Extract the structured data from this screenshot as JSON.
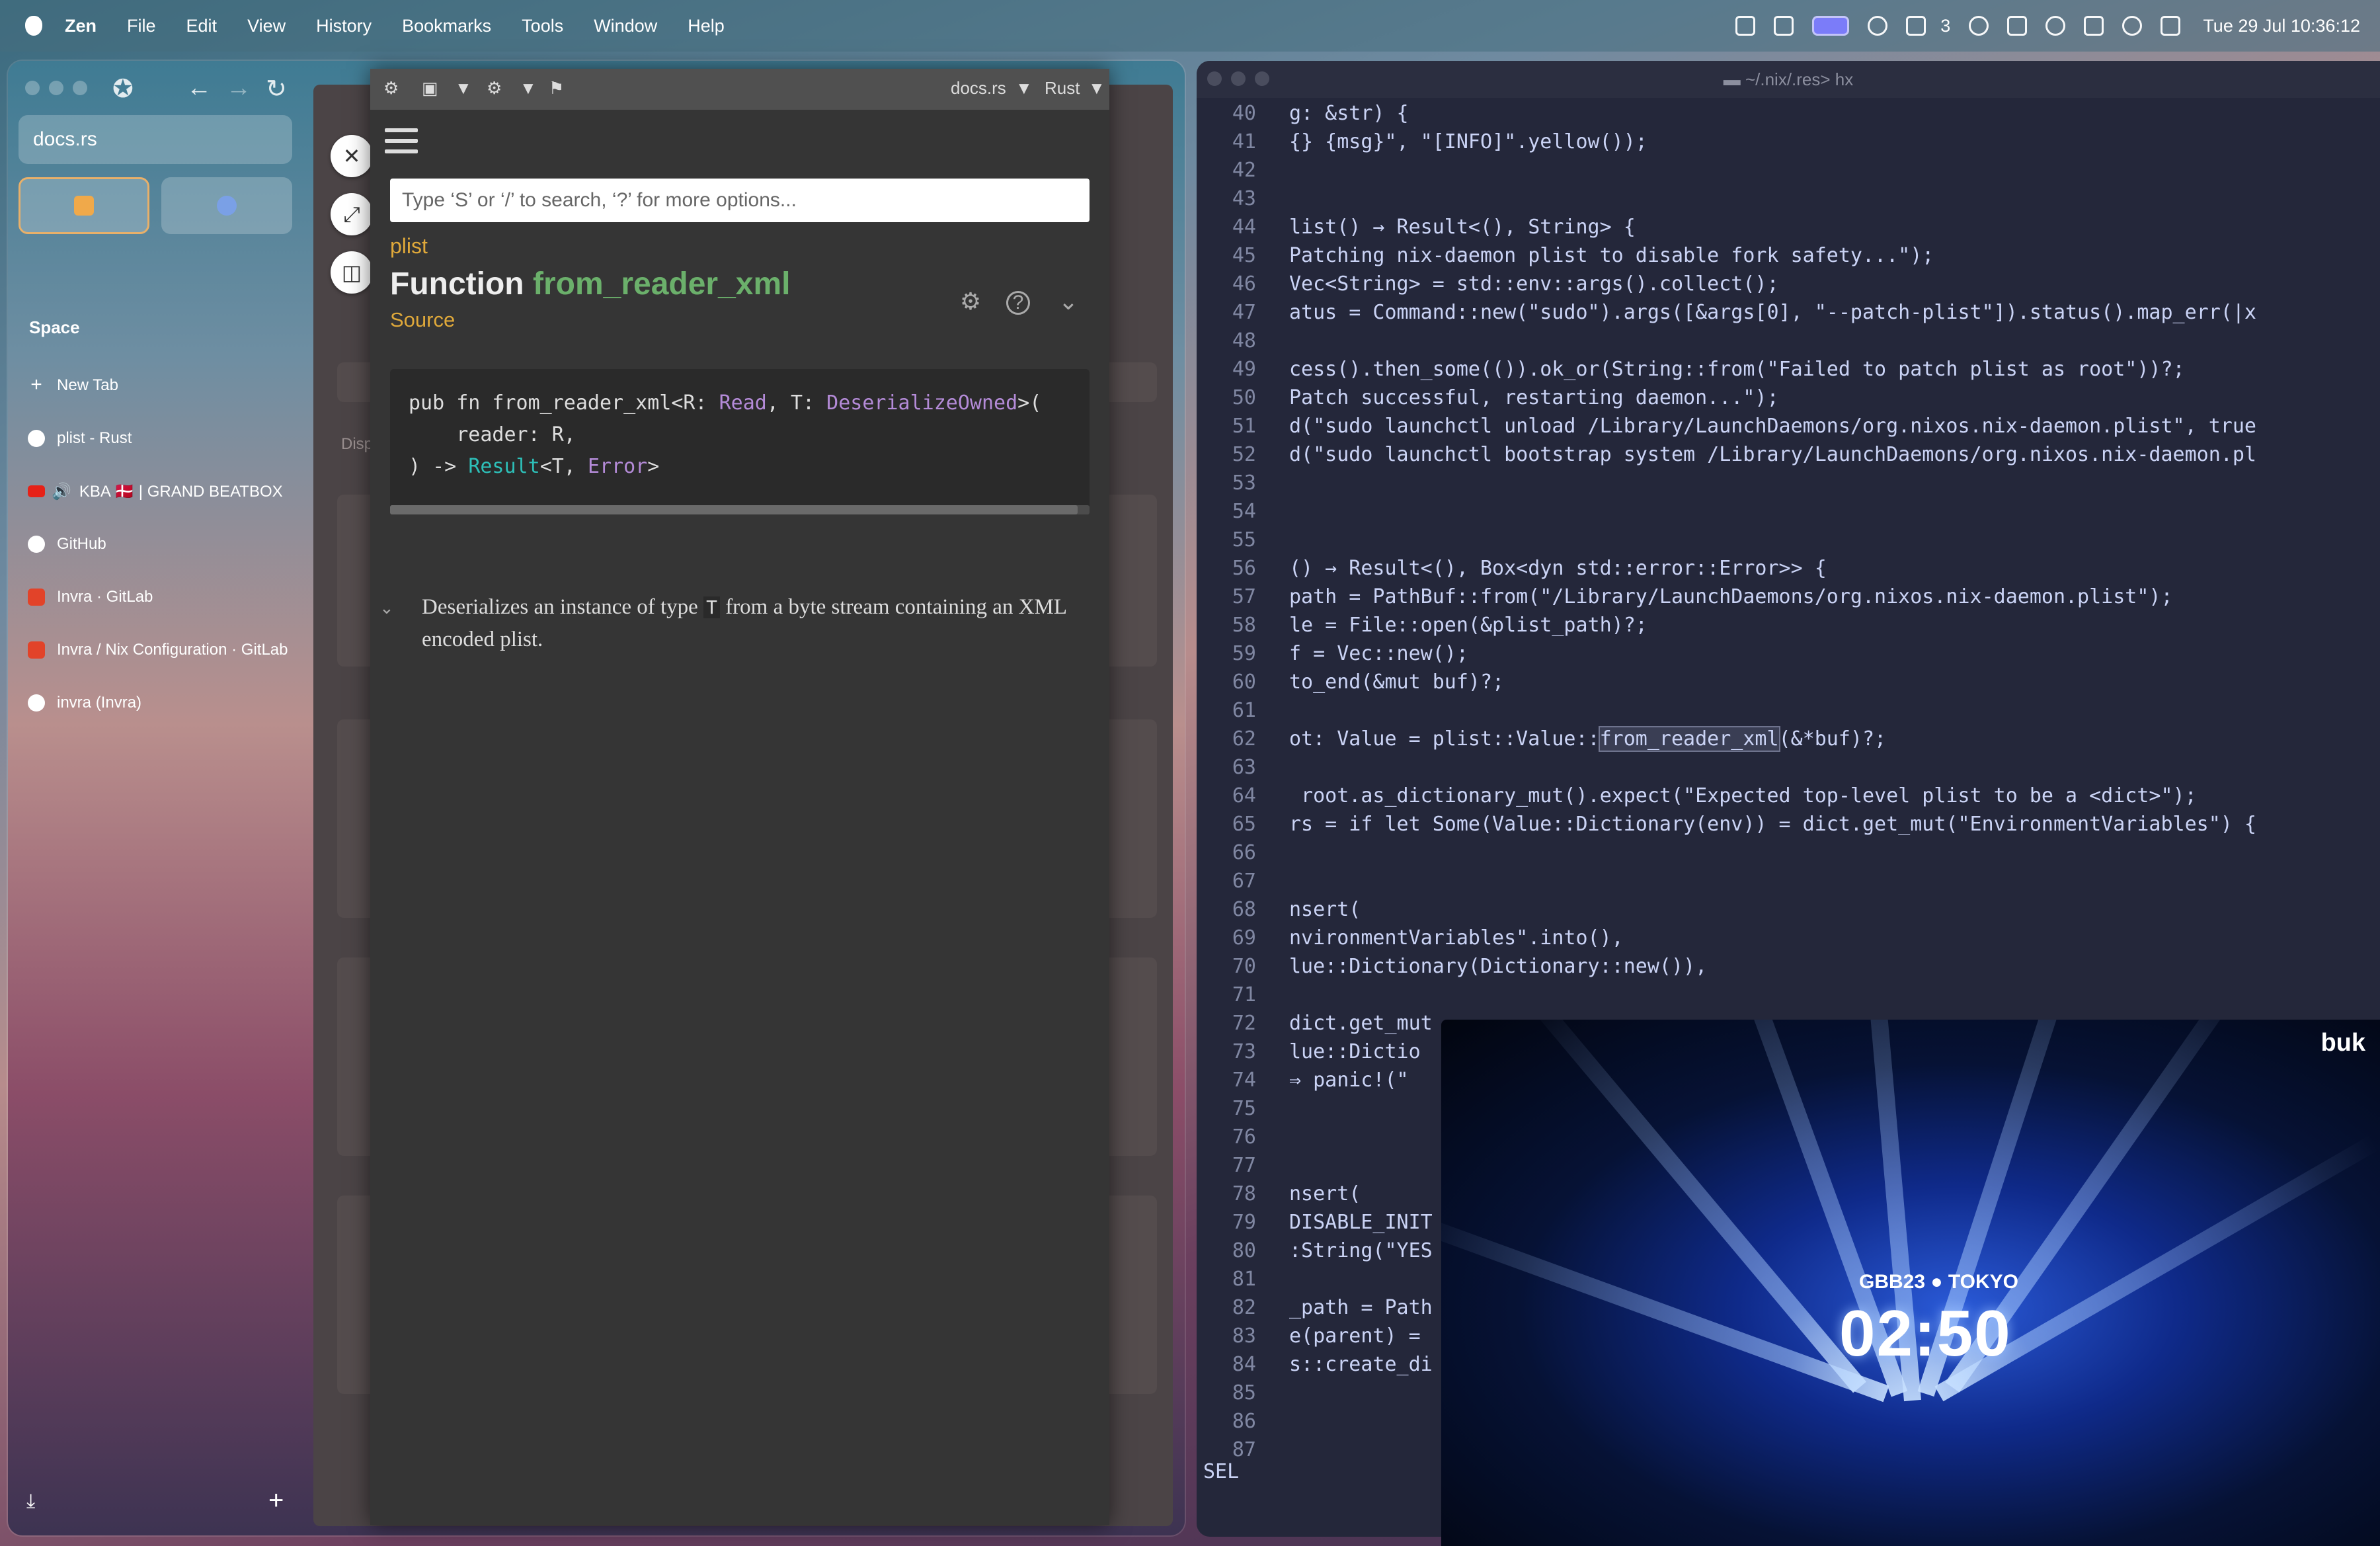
{
  "menubar": {
    "app_name": "Zen",
    "items": [
      "File",
      "Edit",
      "View",
      "History",
      "Bookmarks",
      "Tools",
      "Window",
      "Help"
    ],
    "notification_count": "3",
    "clock": "Tue 29 Jul 10:36:12"
  },
  "browser": {
    "url": "docs.rs",
    "space_label": "Space",
    "tabs": [
      {
        "label": "New Tab",
        "icon": "plus-icon"
      },
      {
        "label": "plist - Rust",
        "icon": "rust-icon"
      },
      {
        "label": "KBA 🇩🇰 | GRAND BEATBOX",
        "icon": "youtube-icon"
      },
      {
        "label": "GitHub",
        "icon": "github-icon"
      },
      {
        "label": "Invra · GitLab",
        "icon": "gitlab-icon"
      },
      {
        "label": "Invra / Nix Configuration · GitLab",
        "icon": "gitlab-icon"
      },
      {
        "label": "invra (Invra)",
        "icon": "github-icon"
      }
    ],
    "bg_page_text": "Displ"
  },
  "docs": {
    "toolbar": {
      "site": "docs.rs",
      "lang": "Rust"
    },
    "search_placeholder": "Type ‘S’ or ‘/’ to search, ‘?’ for more options...",
    "crate": "plist",
    "kind": "Function",
    "fn_name": "from_reader_xml",
    "source_link": "Source",
    "signature": {
      "l1a": "pub fn from_reader_xml<R: ",
      "l1b": "Read",
      "l1c": ", T: ",
      "l1d": "DeserializeOwned",
      "l1e": ">(",
      "l2": "    reader: R,",
      "l3a": ") -> ",
      "l3b": "Result",
      "l3c": "<T, ",
      "l3d": "Error",
      "l3e": ">"
    },
    "desc_a": "Deserializes an instance of type ",
    "desc_code": "T",
    "desc_b": " from a byte stream containing an XML encoded plist."
  },
  "editor": {
    "title": "~/.nix/.res> hx",
    "mode": "SEL",
    "gutter": [
      "40",
      "41",
      "42",
      "43",
      "44",
      "45",
      "46",
      "47",
      "48",
      "49",
      "50",
      "51",
      "52",
      "53",
      "54",
      "55",
      "56",
      "57",
      "58",
      "59",
      "60",
      "61",
      "62",
      "63",
      "64",
      "65",
      "66",
      "67",
      "68",
      "69",
      "70",
      "71",
      "72",
      "73",
      "74",
      "75",
      "76",
      "77",
      "78",
      "79",
      "80",
      "81",
      "82",
      "83",
      "84",
      "85",
      "86",
      "87"
    ],
    "lines": [
      "g: &str) {",
      "{} {msg}\", \"[INFO]\".yellow());",
      "",
      "",
      "list() → Result<(), String> {",
      "Patching nix-daemon plist to disable fork safety...\");",
      "Vec<String> = std::env::args().collect();",
      "atus = Command::new(\"sudo\").args([&args[0], \"--patch-plist\"]).status().map_err(|x",
      "",
      "cess().then_some(()).ok_or(String::from(\"Failed to patch plist as root\"))?;",
      "Patch successful, restarting daemon...\");",
      "d(\"sudo launchctl unload /Library/LaunchDaemons/org.nixos.nix-daemon.plist\", true",
      "d(\"sudo launchctl bootstrap system /Library/LaunchDaemons/org.nixos.nix-daemon.pl",
      "",
      "",
      "",
      "() → Result<(), Box<dyn std::error::Error>> {",
      "path = PathBuf::from(\"/Library/LaunchDaemons/org.nixos.nix-daemon.plist\");",
      "le = File::open(&plist_path)?;",
      "f = Vec::new();",
      "to_end(&mut buf)?;",
      "",
      "ot: Value = plist::Value::from_reader_xml(&*buf)?;",
      "",
      " root.as_dictionary_mut().expect(\"Expected top-level plist to be a <dict>\");",
      "rs = if let Some(Value::Dictionary(env)) = dict.get_mut(\"EnvironmentVariables\") {",
      "",
      "",
      "nsert(",
      "nvironmentVariables\".into(),",
      "lue::Dictionary(Dictionary::new()),",
      "",
      "dict.get_mut",
      "lue::Dictio",
      "⇒ panic!(\"",
      "",
      "",
      "",
      "nsert(",
      "DISABLE_INIT",
      ":String(\"YES",
      "",
      "_path = Path",
      "e(parent) =",
      "s::create_di",
      "",
      ""
    ]
  },
  "video": {
    "logo": "buk",
    "event": "GBB23 ● TOKYO",
    "timer": "02:50"
  }
}
